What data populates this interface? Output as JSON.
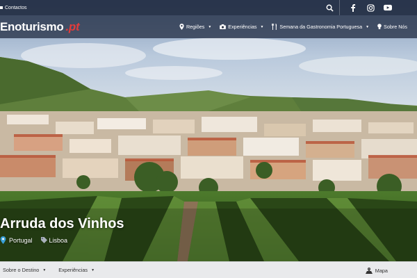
{
  "topbar": {
    "contact_label": "Contactos",
    "icons": [
      "search-icon",
      "facebook-icon",
      "instagram-icon",
      "youtube-icon"
    ]
  },
  "navbar": {
    "logo_main": "Enoturismo",
    "logo_suffix": ".pt",
    "items": [
      {
        "label": "Regiões",
        "icon": "map-pin-icon",
        "has_dropdown": true
      },
      {
        "label": "Experiências",
        "icon": "camera-icon",
        "has_dropdown": true
      },
      {
        "label": "Semana da Gastronomia Portuguesa",
        "icon": "cutlery-icon",
        "has_dropdown": true
      },
      {
        "label": "Sobre Nós",
        "icon": "lightbulb-icon",
        "has_dropdown": false
      }
    ]
  },
  "hero": {
    "title": "Arruda dos Vinhos",
    "country": "Portugal",
    "region": "Lisboa"
  },
  "bottombar": {
    "items": [
      {
        "label": "Sobre o Destino",
        "has_dropdown": true
      },
      {
        "label": "Experiências",
        "has_dropdown": true
      }
    ],
    "map_label": "Mapa"
  },
  "colors": {
    "accent_red": "#e23b3b",
    "location_pin_blue": "#3aa0d8",
    "bar_dark": "#222c42"
  }
}
